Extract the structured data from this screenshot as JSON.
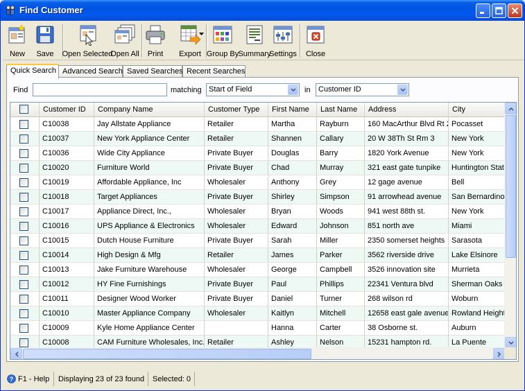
{
  "window": {
    "title": "Find Customer"
  },
  "toolbar": {
    "new": "New",
    "save": "Save",
    "open_selected": "Open Selected",
    "open_all": "Open All",
    "print": "Print",
    "export": "Export",
    "group_by": "Group By",
    "summary": "Summary",
    "settings": "Settings",
    "close": "Close"
  },
  "tabs": [
    "Quick Search",
    "Advanced Search",
    "Saved Searches",
    "Recent Searches"
  ],
  "find": {
    "label": "Find",
    "value": "",
    "matching_label": "matching",
    "matching_value": "Start of Field",
    "in_label": "in",
    "in_value": "Customer ID"
  },
  "grid": {
    "columns": [
      "Customer ID",
      "Company Name",
      "Customer Type",
      "First Name",
      "Last Name",
      "Address",
      "City"
    ],
    "rows": [
      [
        "C10038",
        "Jay Allstate Appliance",
        "Retailer",
        "Martha",
        "Rayburn",
        "160 MacArthur Blvd Rt 2",
        "Pocasset"
      ],
      [
        "C10037",
        "New York Appliance Center",
        "Retailer",
        "Shannen",
        "Callary",
        "20 W 38Th St Rm 3",
        "New York"
      ],
      [
        "C10036",
        "Wide City Appliance",
        "Private Buyer",
        "Douglas",
        "Barry",
        "1820 York Avenue",
        "New York"
      ],
      [
        "C10020",
        "Furniture World",
        "Private Buyer",
        "Chad",
        "Murray",
        "321 east gate tunpike",
        "Huntington Station"
      ],
      [
        "C10019",
        "Affordable Appliance, Inc",
        "Wholesaler",
        "Anthony",
        "Grey",
        "12 gage avenue",
        "Bell"
      ],
      [
        "C10018",
        "Target Appliances",
        "Private Buyer",
        "Shirley",
        "Simpson",
        "91 arrowhead avenue",
        "San Bernardino"
      ],
      [
        "C10017",
        "Appliance Direct, Inc.,",
        "Wholesaler",
        "Bryan",
        "Woods",
        "941 west 88th st.",
        "New York"
      ],
      [
        "C10016",
        "UPS Appliance & Electronics",
        "Wholesaler",
        "Edward",
        "Johnson",
        "851 north ave",
        "Miami"
      ],
      [
        "C10015",
        "Dutch House Furniture",
        "Private Buyer",
        "Sarah",
        "Miller",
        "2350 somerset heights",
        "Sarasota"
      ],
      [
        "C10014",
        "High Design & Mfg",
        "Retailer",
        "James",
        "Parker",
        "3562 riverside drive",
        "Lake Elsinore"
      ],
      [
        "C10013",
        "Jake Furniture Warehouse",
        "Wholesaler",
        "George",
        "Campbell",
        "3526 innovation site",
        "Murrieta"
      ],
      [
        "C10012",
        "HY Fine Furnishings",
        "Private Buyer",
        "Paul",
        "Phillips",
        "22341 Ventura blvd",
        "Sherman Oaks"
      ],
      [
        "C10011",
        "Designer Wood Worker",
        "Private Buyer",
        "Daniel",
        "Turner",
        "268 wilson rd",
        "Woburn"
      ],
      [
        "C10010",
        "Master Appliance Company",
        "Wholesaler",
        "Kaitlyn",
        "Mitchell",
        "12658 east gale avenue",
        "Rowland Heights"
      ],
      [
        "C10009",
        "Kyle Home Appliance Center",
        "",
        "Hanna",
        "Carter",
        "38 Osborne st.",
        "Auburn"
      ],
      [
        "C10008",
        "CAM Furniture Wholesales, Inc.",
        "Retailer",
        "Ashley",
        "Nelson",
        "15231 hampton rd.",
        "La Puente"
      ]
    ]
  },
  "status": {
    "help": "F1 - Help",
    "displaying": "Displaying 23 of 23 found",
    "selected": "Selected: 0"
  },
  "colors": {
    "title_bar": "#0054e3",
    "row_alt": "#eef8f5",
    "tab_highlight": "#ffc83c"
  }
}
